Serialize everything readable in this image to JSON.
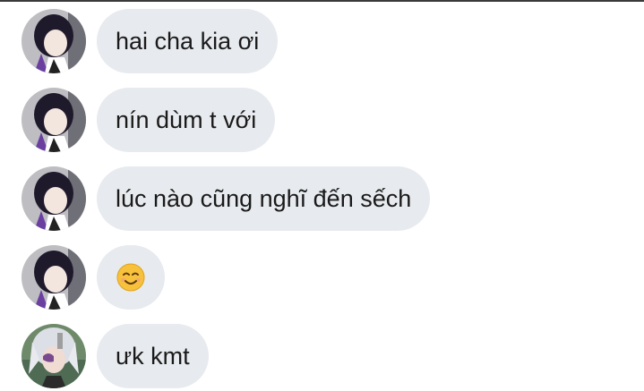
{
  "messages": [
    {
      "sender": "shinobu",
      "text": "hai cha kia ơi"
    },
    {
      "sender": "shinobu",
      "text": "nín dùm t với"
    },
    {
      "sender": "shinobu",
      "text": "lúc nào cũng nghĩ đến sếch"
    },
    {
      "sender": "shinobu",
      "emoji": "smiling-face-icon"
    },
    {
      "sender": "tengen",
      "text": "ưk kmt"
    }
  ],
  "colors": {
    "bubble": "#e7eaee",
    "text": "#1a1a1a",
    "emoji_face": "#f7c13b"
  }
}
